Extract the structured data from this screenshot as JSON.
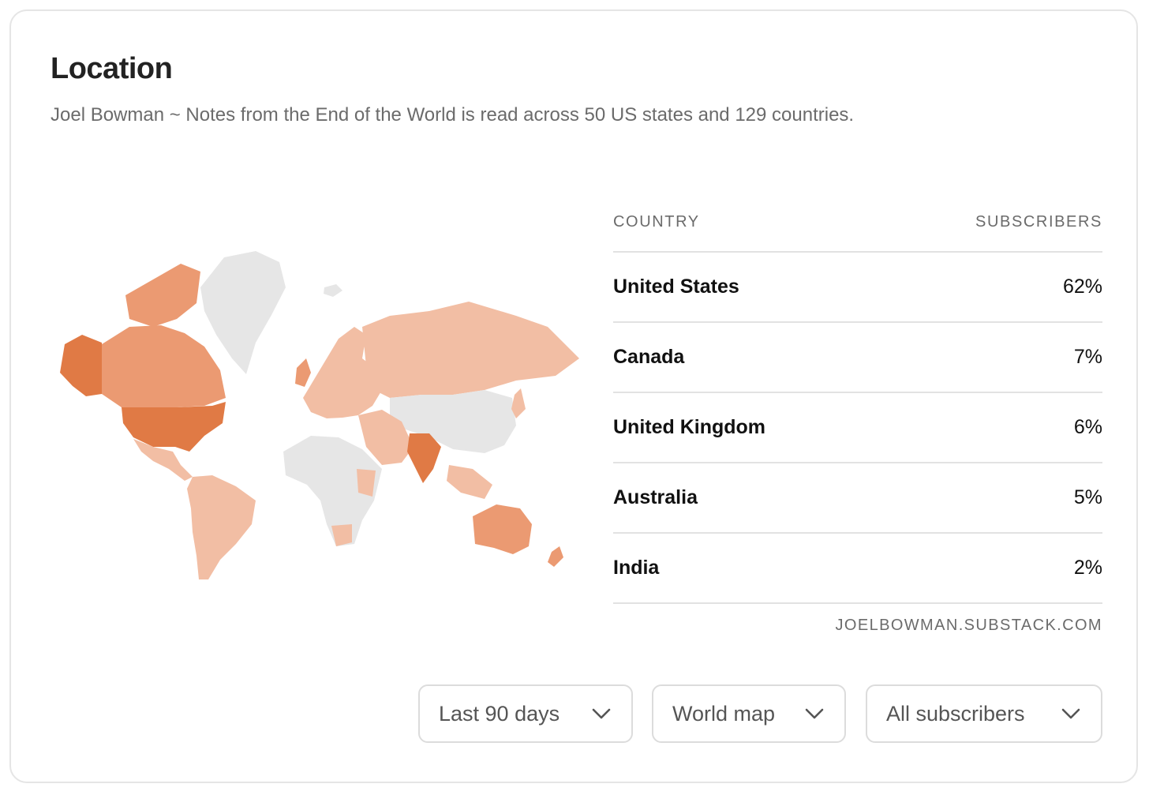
{
  "header": {
    "title": "Location",
    "subtitle": "Joel Bowman ~ Notes from the End of the World is read across 50 US states and 129 countries."
  },
  "table": {
    "col_country": "COUNTRY",
    "col_subscribers": "SUBSCRIBERS",
    "rows": [
      {
        "country": "United States",
        "share": "62%"
      },
      {
        "country": "Canada",
        "share": "7%"
      },
      {
        "country": "United Kingdom",
        "share": "6%"
      },
      {
        "country": "Australia",
        "share": "5%"
      },
      {
        "country": "India",
        "share": "2%"
      }
    ],
    "site": "JOELBOWMAN.SUBSTACK.COM"
  },
  "filters": {
    "period": "Last 90 days",
    "view": "World map",
    "audience": "All subscribers"
  },
  "colors": {
    "high": "#e07a45",
    "mid": "#eb9a72",
    "low": "#f2bea4",
    "none": "#e6e6e6"
  }
}
